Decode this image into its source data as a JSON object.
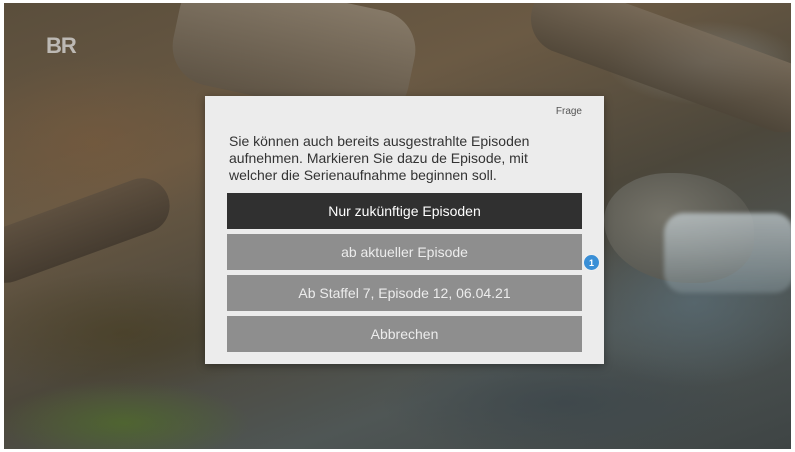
{
  "channel": {
    "logo": "BR"
  },
  "dialog": {
    "title": "Frage",
    "message": "Sie können auch bereits ausgestrahlte Episoden aufnehmen. Markieren Sie dazu de Episode, mit welcher die Serienaufnahme beginnen soll.",
    "options": [
      {
        "label": "Nur zukünftige Episoden",
        "selected": true
      },
      {
        "label": "ab aktueller Episode",
        "selected": false
      },
      {
        "label": "Ab Staffel 7, Episode 12, 06.04.21",
        "selected": false
      },
      {
        "label": "Abbrechen",
        "selected": false
      }
    ]
  },
  "annotation": {
    "badge": "1",
    "color": "#3a8fd6"
  },
  "colors": {
    "dialog_bg": "#ececec",
    "option_selected_bg": "#303030",
    "option_bg": "#8e8e8e"
  }
}
